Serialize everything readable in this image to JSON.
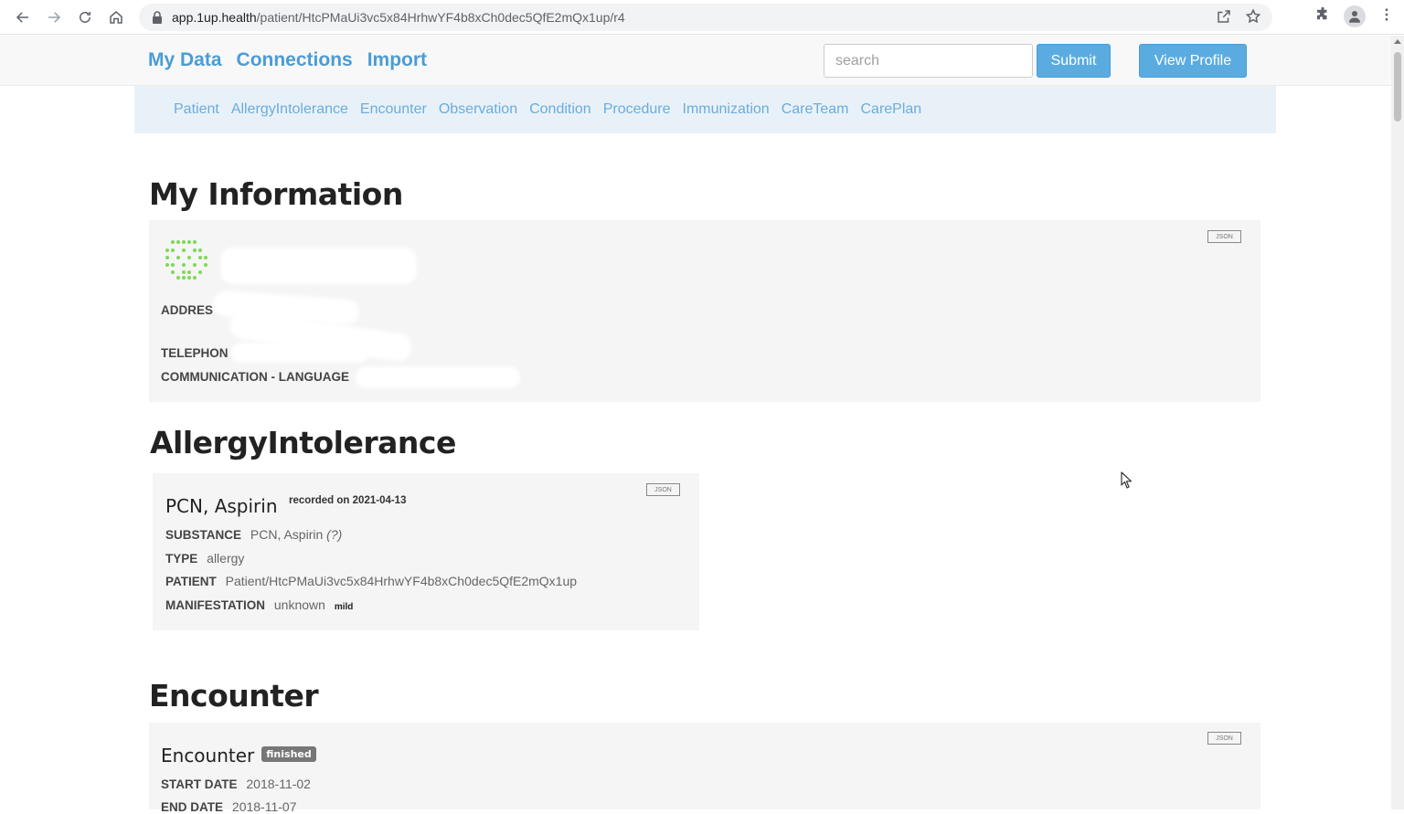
{
  "browser": {
    "url_host": "app.1up.health",
    "url_path": "/patient/HtcPMaUi3vc5x84HrhwYF4b8xCh0dec5QfE2mQx1up/r4"
  },
  "header": {
    "nav": [
      "My Data",
      "Connections",
      "Import"
    ],
    "search_placeholder": "search",
    "submit_label": "Submit",
    "view_profile_label": "View Profile"
  },
  "subnav": [
    "Patient",
    "AllergyIntolerance",
    "Encounter",
    "Observation",
    "Condition",
    "Procedure",
    "Immunization",
    "CareTeam",
    "CarePlan"
  ],
  "my_information": {
    "heading": "My Information",
    "json_label": "JSON",
    "fields": [
      {
        "label": "ADDRES",
        "value": ""
      },
      {
        "label": "TELEPHON",
        "value": ""
      },
      {
        "label": "COMMUNICATION - LANGUAGE",
        "value": ""
      }
    ]
  },
  "allergy": {
    "heading": "AllergyIntolerance",
    "json_label": "JSON",
    "title": "PCN, Aspirin",
    "recorded": "recorded on 2021-04-13",
    "fields": [
      {
        "label": "SUBSTANCE",
        "value": "PCN, Aspirin",
        "extra": "(?)"
      },
      {
        "label": "TYPE",
        "value": "allergy"
      },
      {
        "label": "PATIENT",
        "value": "Patient/HtcPMaUi3vc5x84HrhwYF4b8xCh0dec5QfE2mQx1up"
      },
      {
        "label": "MANIFESTATION",
        "value": "unknown",
        "severity": "mild"
      }
    ]
  },
  "encounter": {
    "heading": "Encounter",
    "json_label": "JSON",
    "title": "Encounter",
    "status": "finished",
    "fields": [
      {
        "label": "START DATE",
        "value": "2018-11-02"
      },
      {
        "label": "END DATE",
        "value": "2018-11-07"
      }
    ]
  }
}
